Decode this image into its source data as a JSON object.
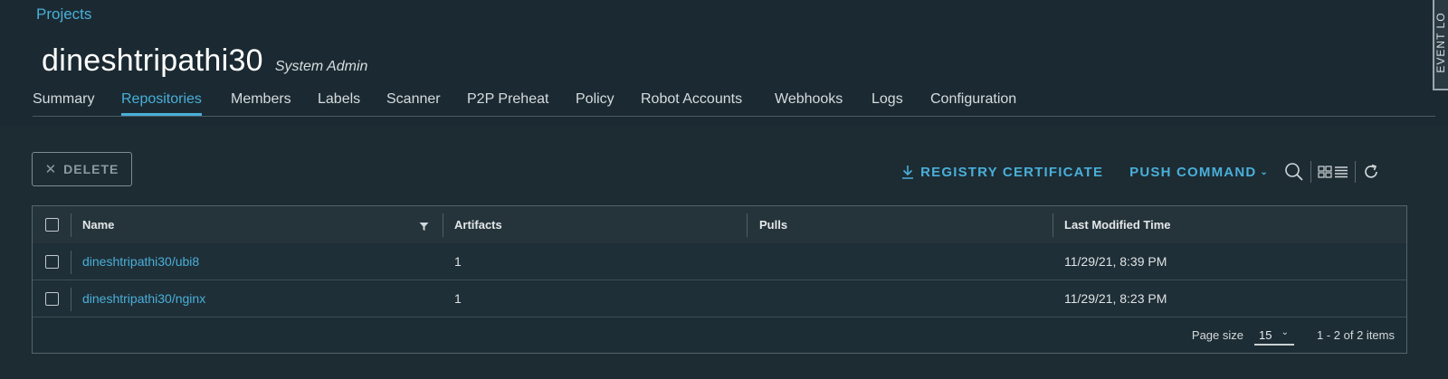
{
  "breadcrumb": "Projects",
  "project": {
    "title": "dineshtripathi30",
    "role": "System Admin"
  },
  "tabs": [
    {
      "label": "Summary",
      "active": false
    },
    {
      "label": "Repositories",
      "active": true
    },
    {
      "label": "Members",
      "active": false
    },
    {
      "label": "Labels",
      "active": false
    },
    {
      "label": "Scanner",
      "active": false
    },
    {
      "label": "P2P Preheat",
      "active": false
    },
    {
      "label": "Policy",
      "active": false
    },
    {
      "label": "Robot Accounts",
      "active": false
    },
    {
      "label": "Webhooks",
      "active": false
    },
    {
      "label": "Logs",
      "active": false
    },
    {
      "label": "Configuration",
      "active": false
    }
  ],
  "event_log_label": "EVENT LO",
  "toolbar": {
    "delete_label": "DELETE",
    "registry_certificate_label": "REGISTRY CERTIFICATE",
    "push_command_label": "PUSH COMMAND"
  },
  "table": {
    "columns": [
      "Name",
      "Artifacts",
      "Pulls",
      "Last Modified Time"
    ],
    "rows": [
      {
        "name": "dineshtripathi30/ubi8",
        "artifacts": "1",
        "pulls": "",
        "modified": "11/29/21, 8:39 PM"
      },
      {
        "name": "dineshtripathi30/nginx",
        "artifacts": "1",
        "pulls": "",
        "modified": "11/29/21, 8:23 PM"
      }
    ],
    "page_size_label": "Page size",
    "page_size_value": "15",
    "range_text": "1 - 2 of 2 items"
  },
  "colors": {
    "accent": "#49afd9",
    "background": "#1b2a32"
  },
  "icons": [
    "close-icon",
    "download-icon",
    "chevron-down-icon",
    "search-icon",
    "card-view-icon",
    "list-view-icon",
    "refresh-icon",
    "filter-icon"
  ]
}
